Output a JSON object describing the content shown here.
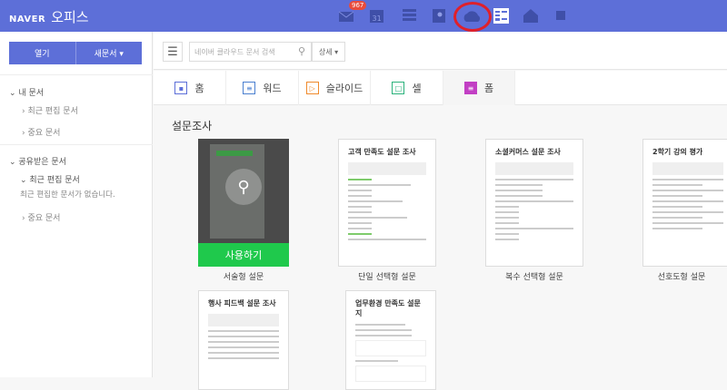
{
  "header": {
    "brand": "NAVER",
    "product": "오피스",
    "mail_badge": "967",
    "icons": [
      "mail-icon",
      "calendar-icon",
      "list-icon",
      "contacts-icon",
      "cloud-icon",
      "office-icon",
      "home-w-icon",
      "more-icon"
    ],
    "calendar_day": "31"
  },
  "sidebar": {
    "open_label": "열기",
    "new_doc_label": "새문서 ▾",
    "my_docs": {
      "label": "내 문서",
      "items": [
        "최근 편집 문서",
        "중요 문서"
      ]
    },
    "shared_docs": {
      "label": "공유받은 문서",
      "recent": "최근 편집 문서",
      "empty_msg": "최근 편집한 문서가 없습니다.",
      "important": "중요 문서"
    }
  },
  "toolbar": {
    "search_placeholder": "네이버 클라우드 문서 검색",
    "detail_label": "상세 ▾"
  },
  "tabs": [
    {
      "label": "홈",
      "color": "#5d6fd8"
    },
    {
      "label": "워드",
      "color": "#4a7fd0"
    },
    {
      "label": "슬라이드",
      "color": "#f08a2c"
    },
    {
      "label": "셀",
      "color": "#2ab27b"
    },
    {
      "label": "폼",
      "color": "#c23fc4"
    }
  ],
  "section": {
    "title": "설문조사",
    "use_button": "사용하기",
    "templates": [
      {
        "title": "",
        "label": "서술형 설문"
      },
      {
        "title": "고객 만족도 설문 조사",
        "label": "단일 선택형 설문"
      },
      {
        "title": "소셜커머스 설문 조사",
        "label": "복수 선택형 설문"
      },
      {
        "title": "2학기 강의 평가",
        "label": "선호도형 설문"
      },
      {
        "title": "행사 피드백 설문 조사",
        "label": ""
      },
      {
        "title": "업무환경 만족도 설문지",
        "label": ""
      }
    ]
  }
}
